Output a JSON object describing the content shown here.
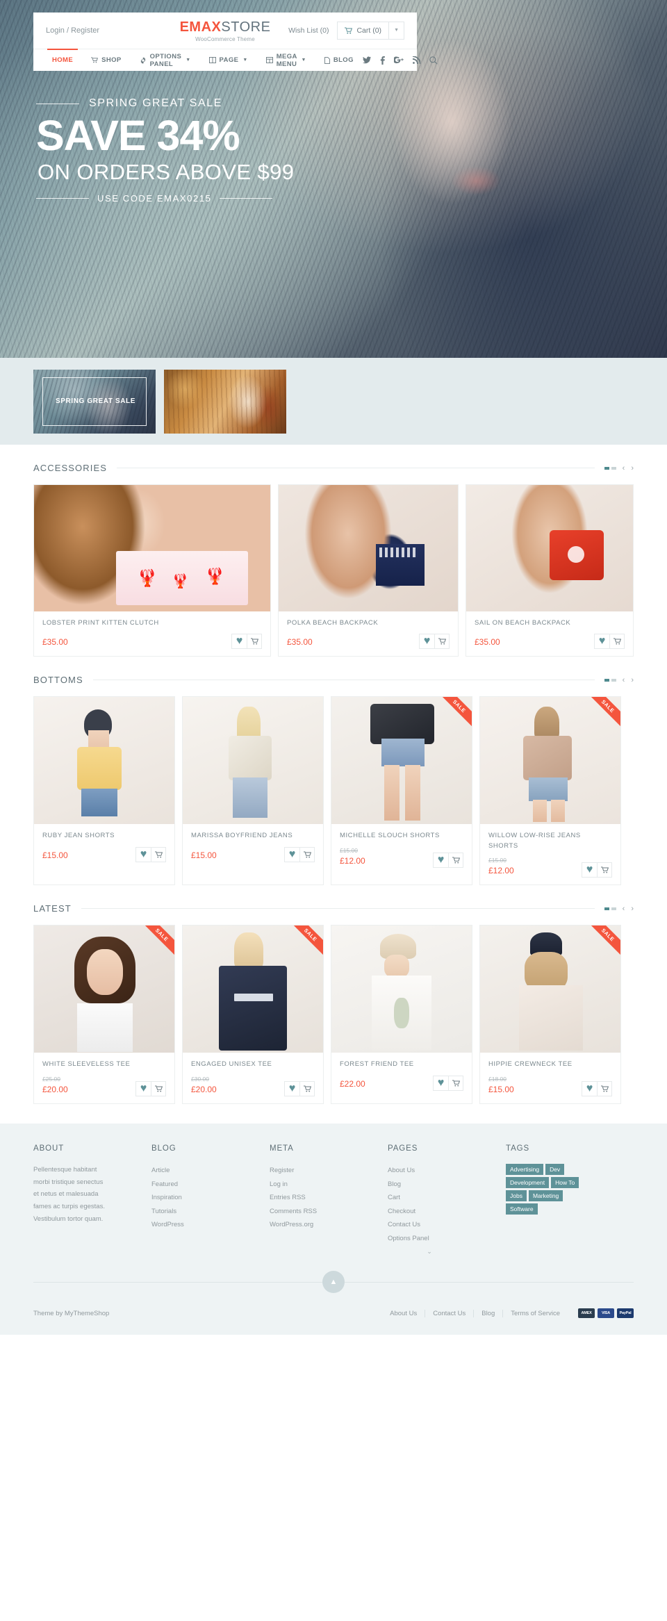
{
  "header": {
    "login_label": "Login / Register",
    "brand_emax": "EMAX",
    "brand_store": "STORE",
    "brand_tagline": "WooCommerce Theme",
    "wishlist_label": "Wish List (0)",
    "cart_label": "Cart (0)"
  },
  "nav": {
    "items": [
      {
        "label": "HOME",
        "icon": "",
        "caret": false,
        "active": true
      },
      {
        "label": "SHOP",
        "icon": "cart-icon",
        "caret": false,
        "active": false
      },
      {
        "label": "OPTIONS PANEL",
        "icon": "gear-icon",
        "caret": true,
        "active": false
      },
      {
        "label": "PAGE",
        "icon": "columns-icon",
        "caret": true,
        "active": false
      },
      {
        "label": "MEGA MENU",
        "icon": "grid-icon",
        "caret": true,
        "active": false
      },
      {
        "label": "BLOG",
        "icon": "file-icon",
        "caret": false,
        "active": false
      }
    ],
    "social": [
      "twitter-icon",
      "facebook-icon",
      "google-plus-icon",
      "rss-icon",
      "search-icon"
    ]
  },
  "hero": {
    "eyebrow": "SPRING GREAT SALE",
    "headline": "SAVE 34%",
    "subhead": "ON ORDERS ABOVE $99",
    "code_text": "USE CODE EMAX0215"
  },
  "promo_thumbs": [
    {
      "label": "SPRING GREAT SALE",
      "name": "promo-banner-spring"
    },
    {
      "label": "",
      "name": "promo-banner-autumn"
    }
  ],
  "sections": [
    {
      "title": "ACCESSORIES",
      "products": [
        {
          "title": "LOBSTER PRINT KITTEN CLUTCH",
          "price": "£35.00",
          "old_price": "",
          "sale": false,
          "wide": true
        },
        {
          "title": "POLKA BEACH BACKPACK",
          "price": "£35.00",
          "old_price": "",
          "sale": false,
          "wide": false
        },
        {
          "title": "SAIL ON BEACH BACKPACK",
          "price": "£35.00",
          "old_price": "",
          "sale": false,
          "wide": false
        }
      ]
    },
    {
      "title": "BOTTOMS",
      "products": [
        {
          "title": "RUBY JEAN SHORTS",
          "price": "£15.00",
          "old_price": "",
          "sale": false
        },
        {
          "title": "MARISSA BOYFRIEND JEANS",
          "price": "£15.00",
          "old_price": "",
          "sale": false
        },
        {
          "title": "MICHELLE SLOUCH SHORTS",
          "price": "£12.00",
          "old_price": "£15.00",
          "sale": true
        },
        {
          "title": "WILLOW LOW-RISE JEANS SHORTS",
          "price": "£12.00",
          "old_price": "£15.00",
          "sale": true
        }
      ]
    },
    {
      "title": "LATEST",
      "products": [
        {
          "title": "WHITE SLEEVELESS TEE",
          "price": "£20.00",
          "old_price": "£25.00",
          "sale": true
        },
        {
          "title": "ENGAGED UNISEX TEE",
          "price": "£20.00",
          "old_price": "£30.00",
          "sale": true
        },
        {
          "title": "FOREST FRIEND TEE",
          "price": "£22.00",
          "old_price": "",
          "sale": false
        },
        {
          "title": "HIPPIE CREWNECK TEE",
          "price": "£15.00",
          "old_price": "£18.00",
          "sale": true
        }
      ]
    }
  ],
  "footer": {
    "about_title": "ABOUT",
    "about_text": "Pellentesque habitant morbi tristique senectus et netus et malesuada fames ac turpis egestas. Vestibulum tortor quam.",
    "blog_title": "BLOG",
    "blog_links": [
      "Article",
      "Featured",
      "Inspiration",
      "Tutorials",
      "WordPress"
    ],
    "meta_title": "META",
    "meta_links": [
      "Register",
      "Log in",
      "Entries RSS",
      "Comments RSS",
      "WordPress.org"
    ],
    "pages_title": "PAGES",
    "pages_links": [
      "About Us",
      "Blog",
      "Cart",
      "Checkout",
      "Contact Us",
      "Options Panel"
    ],
    "tags_title": "TAGS",
    "tags": [
      "Advertising",
      "Dev",
      "Development",
      "How To",
      "Jobs",
      "Marketing",
      "Software"
    ],
    "back_to_top": "▲",
    "copyright": "Theme by MyThemeShop",
    "bottom_links": [
      "About Us",
      "Contact Us",
      "Blog",
      "Terms of Service"
    ],
    "payments": [
      "AMEX",
      "VISA",
      "PayPal"
    ]
  },
  "icons": {
    "heart": "♥",
    "sale_badge": "SALE"
  }
}
